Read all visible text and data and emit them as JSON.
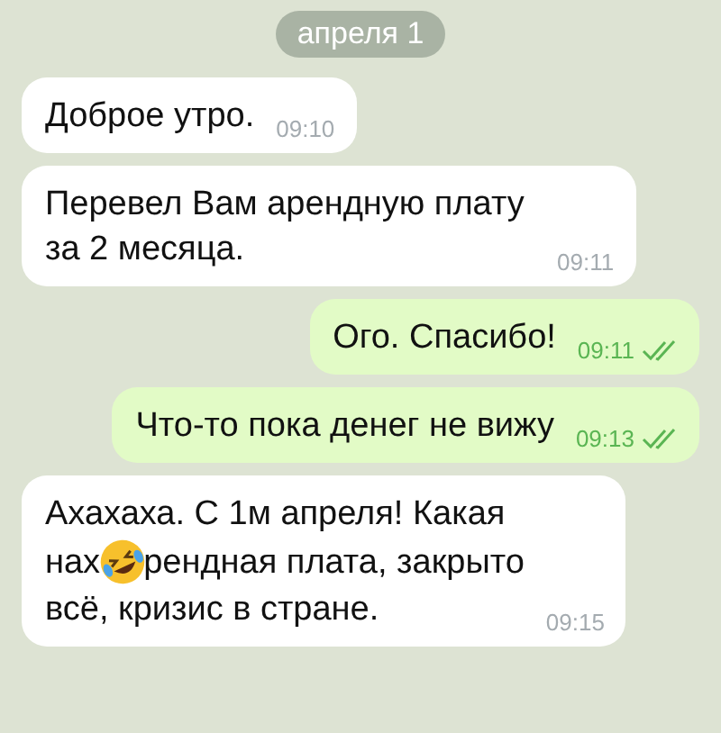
{
  "date_badge": "апреля 1",
  "messages": [
    {
      "outgoing": false,
      "lines": [
        [
          {
            "kind": "text",
            "text": "Доброе утро."
          }
        ]
      ],
      "time": "09:10",
      "read": false
    },
    {
      "outgoing": false,
      "lines": [
        [
          {
            "kind": "text",
            "text": "Перевел Вам арендную плату за 2 месяца."
          }
        ]
      ],
      "time": "09:11",
      "read": false
    },
    {
      "outgoing": true,
      "lines": [
        [
          {
            "kind": "text",
            "text": "Ого. Спасибо!"
          }
        ]
      ],
      "time": "09:11",
      "read": true
    },
    {
      "outgoing": true,
      "lines": [
        [
          {
            "kind": "text",
            "text": "Что-то пока денег не вижу"
          }
        ]
      ],
      "time": "09:13",
      "read": true
    },
    {
      "outgoing": false,
      "lines": [
        [
          {
            "kind": "text",
            "text": "Ахахаха. С 1м апреля! Какая"
          }
        ],
        [
          {
            "kind": "text",
            "text": "нах"
          },
          {
            "kind": "emoji"
          },
          {
            "kind": "text",
            "text": "рендная плата, закрыто"
          }
        ],
        [
          {
            "kind": "text",
            "text": "всё, кризис в стране."
          }
        ]
      ],
      "time": "09:15",
      "read": false
    }
  ]
}
